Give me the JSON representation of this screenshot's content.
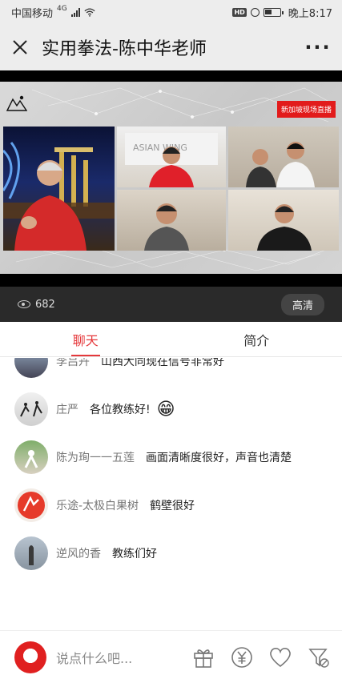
{
  "status_bar": {
    "carrier": "中国移动",
    "network": "4G",
    "time": "晚上8:17",
    "hd": "HD"
  },
  "header": {
    "title": "实用拳法-陈中华老师",
    "close_icon": "close-icon",
    "more_label": "···"
  },
  "video": {
    "live_badge": "新加坡现场直播",
    "views": "682",
    "quality": "高清"
  },
  "tabs": [
    {
      "label": "聊天",
      "active": true
    },
    {
      "label": "简介",
      "active": false
    }
  ],
  "chat": [
    {
      "nick": "李吕卉",
      "text": "山西大同现在信号非常好"
    },
    {
      "nick": "庄严",
      "text": "各位教练好!",
      "emoji": "😁"
    },
    {
      "nick": "陈为珣一一五莲",
      "text": "画面清晰度很好，声音也清楚"
    },
    {
      "nick": "乐途-太极白果树",
      "text": "鹤壁很好"
    },
    {
      "nick": "逆风的香",
      "text": "教练们好"
    }
  ],
  "composer": {
    "placeholder": "说点什么吧..."
  },
  "actions": [
    "gift-icon",
    "yuan-icon",
    "heart-icon",
    "filter-off-icon"
  ],
  "colors": {
    "accent": "#e5383b",
    "live": "#e21b1b"
  }
}
